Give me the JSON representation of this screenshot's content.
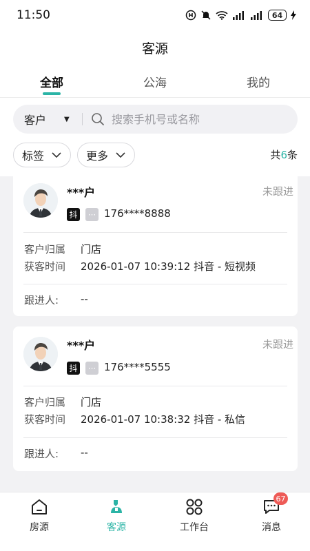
{
  "status_bar": {
    "time": "11:50",
    "battery": "64"
  },
  "header": {
    "title": "客源"
  },
  "tabs": [
    {
      "label": "全部",
      "active": true
    },
    {
      "label": "公海",
      "active": false
    },
    {
      "label": "我的",
      "active": false
    }
  ],
  "search": {
    "type_label": "客户",
    "placeholder": "搜索手机号或名称"
  },
  "filters": {
    "tag_label": "标签",
    "more_label": "更多"
  },
  "count": {
    "prefix": "共",
    "number": "6",
    "suffix": "条"
  },
  "customers": [
    {
      "name": "***户",
      "status": "未跟进",
      "source_badge": "抖",
      "chat_badge": "···",
      "phone": "176****8888",
      "owner_label": "客户归属",
      "owner": "门店",
      "time_label": "获客时间",
      "time": "2026-01-07 10:39:12 抖音 - 短视频",
      "follower_label": "跟进人:",
      "follower": "--"
    },
    {
      "name": "***户",
      "status": "未跟进",
      "source_badge": "抖",
      "chat_badge": "···",
      "phone": "176****5555",
      "owner_label": "客户归属",
      "owner": "门店",
      "time_label": "获客时间",
      "time": "2026-01-07 10:38:32 抖音 - 私信",
      "follower_label": "跟进人:",
      "follower": "--"
    }
  ],
  "bottom_nav": [
    {
      "label": "房源",
      "icon": "home-icon",
      "active": false
    },
    {
      "label": "客源",
      "icon": "customer-icon",
      "active": true
    },
    {
      "label": "工作台",
      "icon": "workbench-icon",
      "active": false
    },
    {
      "label": "消息",
      "icon": "message-icon",
      "active": false,
      "badge": "67"
    }
  ],
  "colors": {
    "accent": "#2bb4a6",
    "badge": "#ee5b57",
    "background": "#f2f2f4"
  }
}
